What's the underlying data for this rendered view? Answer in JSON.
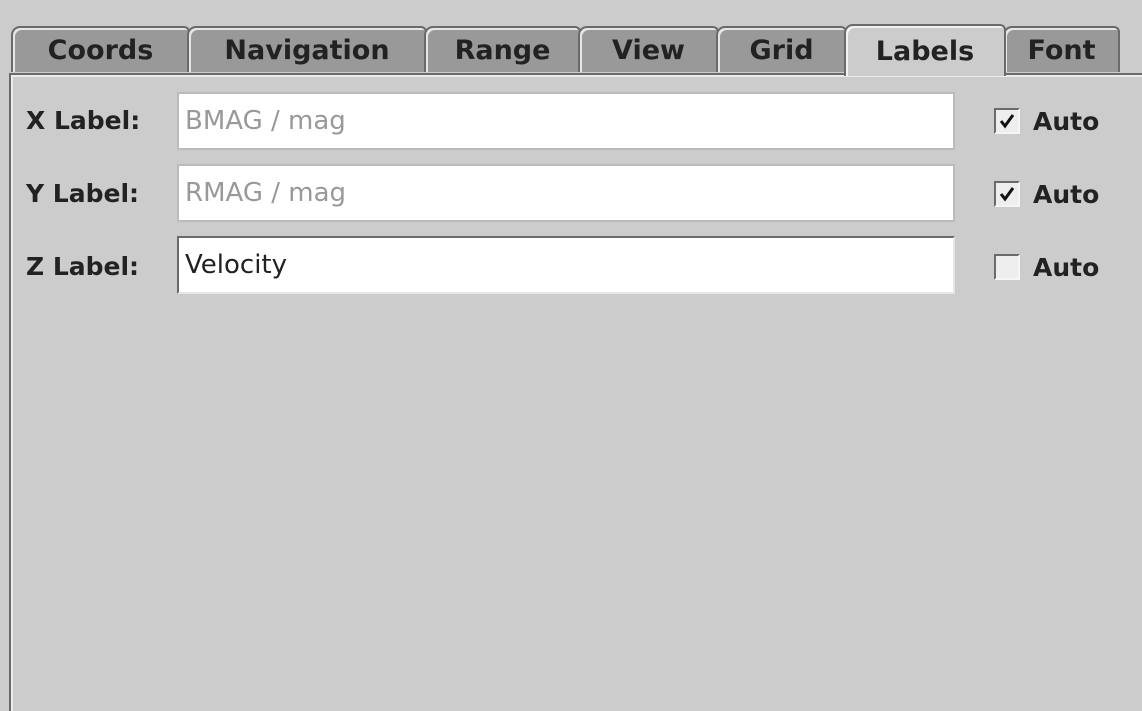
{
  "tabs": [
    {
      "label": "Coords",
      "selected": false
    },
    {
      "label": "Navigation",
      "selected": false
    },
    {
      "label": "Range",
      "selected": false
    },
    {
      "label": "View",
      "selected": false
    },
    {
      "label": "Grid",
      "selected": false
    },
    {
      "label": "Labels",
      "selected": true
    },
    {
      "label": "Font",
      "selected": false
    }
  ],
  "rows": [
    {
      "label": "X Label:",
      "value": "BMAG / mag",
      "editable": false,
      "auto": true,
      "auto_label": "Auto"
    },
    {
      "label": "Y Label:",
      "value": "RMAG / mag",
      "editable": false,
      "auto": true,
      "auto_label": "Auto"
    },
    {
      "label": "Z Label:",
      "value": "Velocity",
      "editable": true,
      "auto": false,
      "auto_label": "Auto"
    }
  ],
  "icons": {
    "check": "check-icon"
  }
}
